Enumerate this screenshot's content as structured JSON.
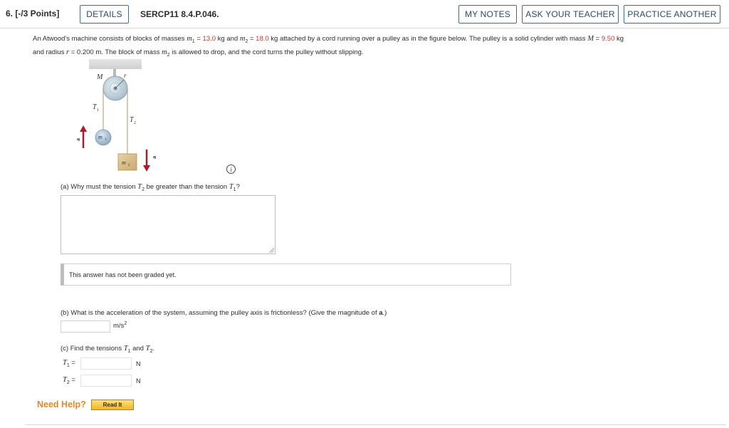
{
  "header": {
    "question_number": "6. [-/3 Points]",
    "details_label": "DETAILS",
    "problem_code": "SERCP11 8.4.P.046.",
    "my_notes_label": "MY NOTES",
    "ask_teacher_label": "ASK YOUR TEACHER",
    "practice_label": "PRACTICE ANOTHER"
  },
  "problem": {
    "t1": "An Atwood's machine consists of blocks of masses ",
    "m1_sym": "m",
    "m1_sub": "1",
    "t2": " = ",
    "m1_val": "13.0",
    "t3": " kg and ",
    "m2_sym": "m",
    "m2_sub": "2",
    "t4": " = ",
    "m2_val": "18.0",
    "t5": " kg attached by a cord running over a pulley as in the figure below. The pulley is a solid cylinder with mass ",
    "M_sym": "M",
    "t6": " = ",
    "M_val": "9.50",
    "t7": " kg",
    "t8": "and radius ",
    "r_sym": "r",
    "t9": " = 0.200 m. The block of mass ",
    "m2b_sym": "m",
    "m2b_sub": "2",
    "t10": " is allowed to drop, and the cord turns the pulley without slipping."
  },
  "figure": {
    "M_label": "M",
    "r_label": "r",
    "T1_label": "T",
    "T1_sub": "1",
    "T2_label": "T",
    "T2_sub": "2",
    "m1_label": "m",
    "m1_sub": "1",
    "m2_label": "m",
    "m2_sub": "2",
    "a_label": "a"
  },
  "info_icon": "i",
  "part_a": {
    "q1": "(a) Why must the tension ",
    "T2": "T",
    "T2_sub": "2",
    "q2": " be greater than the tension ",
    "T1": "T",
    "T1_sub": "1",
    "q3": "?",
    "answer": ""
  },
  "graded_message": "This answer has not been graded yet.",
  "part_b": {
    "q1": "(b) What is the acceleration of the system, assuming the pulley axis is frictionless? (Give the magnitude of ",
    "a_sym": "a",
    "q2": ".)",
    "value": "",
    "unit": "m/s",
    "unit_exp": "2"
  },
  "part_c": {
    "q1": "(c) Find the tensions ",
    "T1": "T",
    "T1_sub": "1",
    "q2": " and ",
    "T2": "T",
    "T2_sub": "2",
    "q3": ".",
    "t1_label_sym": "T",
    "t1_label_sub": "1",
    "t1_eq": " =",
    "t1_value": "",
    "t1_unit": "N",
    "t2_label_sym": "T",
    "t2_label_sub": "2",
    "t2_eq": " =",
    "t2_value": "",
    "t2_unit": "N"
  },
  "help": {
    "need_help": "Need Help?",
    "read_it": "Read It"
  }
}
